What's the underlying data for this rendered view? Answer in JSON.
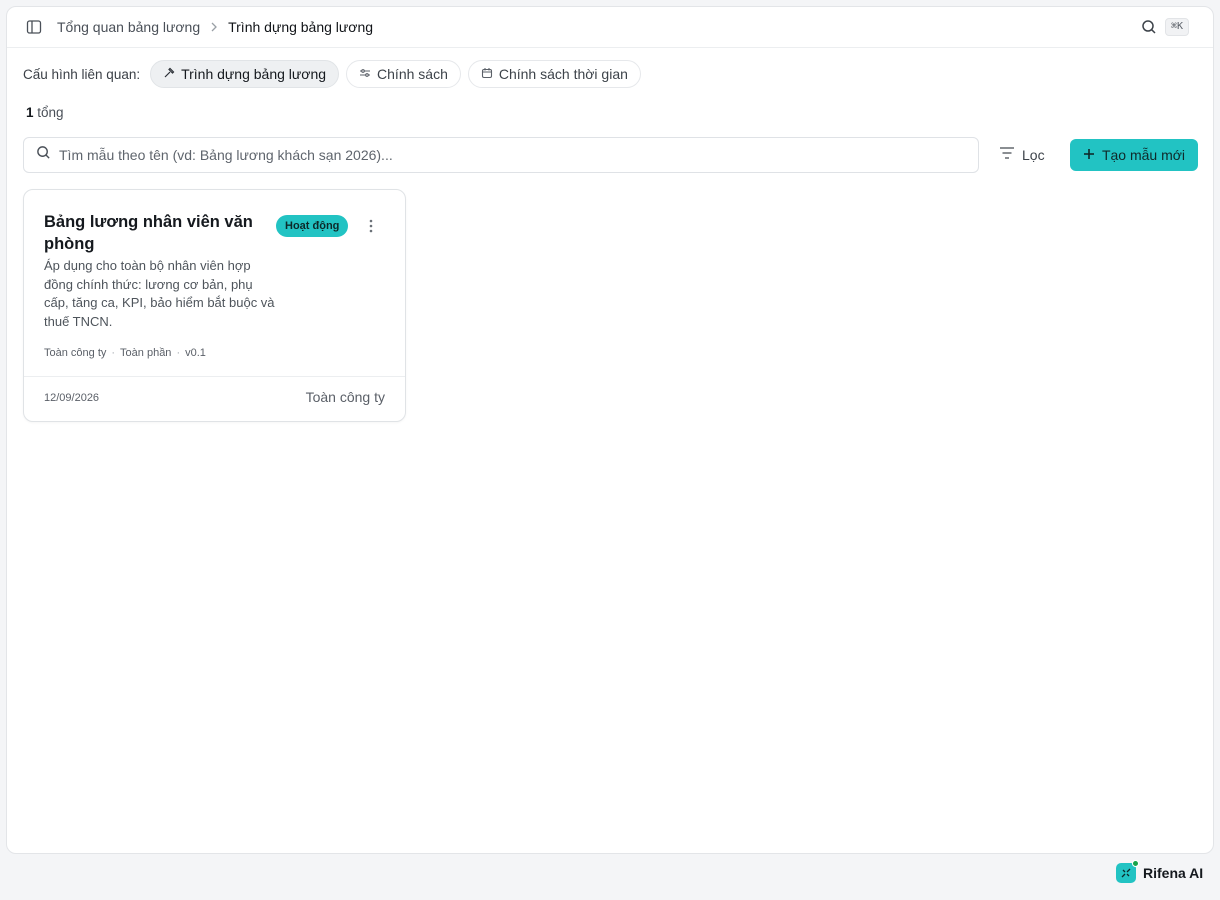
{
  "breadcrumb": {
    "parent": "Tổng quan bảng lương",
    "current": "Trình dựng bảng lương"
  },
  "search_shortcut": "⌘K",
  "related": {
    "label": "Cấu hình liên quan:",
    "chips": [
      {
        "label": "Trình dựng bảng lương",
        "icon": "hammer-icon",
        "active": true
      },
      {
        "label": "Chính sách",
        "icon": "sliders-icon",
        "active": false
      },
      {
        "label": "Chính sách thời gian",
        "icon": "calendar-icon",
        "active": false
      }
    ]
  },
  "total": {
    "count": "1",
    "label": "tổng"
  },
  "search": {
    "placeholder": "Tìm mẫu theo tên (vd: Bảng lương khách sạn 2026)..."
  },
  "filter_label": "Lọc",
  "create_label": "Tạo mẫu mới",
  "templates": [
    {
      "title": "Bảng lương nhân viên văn phòng",
      "status": "Hoạt động",
      "description": "Áp dụng cho toàn bộ nhân viên hợp đồng chính thức: lương cơ bản, phụ cấp, tăng ca, KPI, bảo hiểm bắt buộc và thuế TNCN.",
      "meta": [
        "Toàn công ty",
        "Toàn phần",
        "v0.1"
      ],
      "date": "12/09/2026",
      "scope": "Toàn công ty"
    }
  ],
  "assistant": {
    "label": "Rifena AI"
  },
  "colors": {
    "accent": "#22c3c3",
    "online": "#16a34a"
  }
}
